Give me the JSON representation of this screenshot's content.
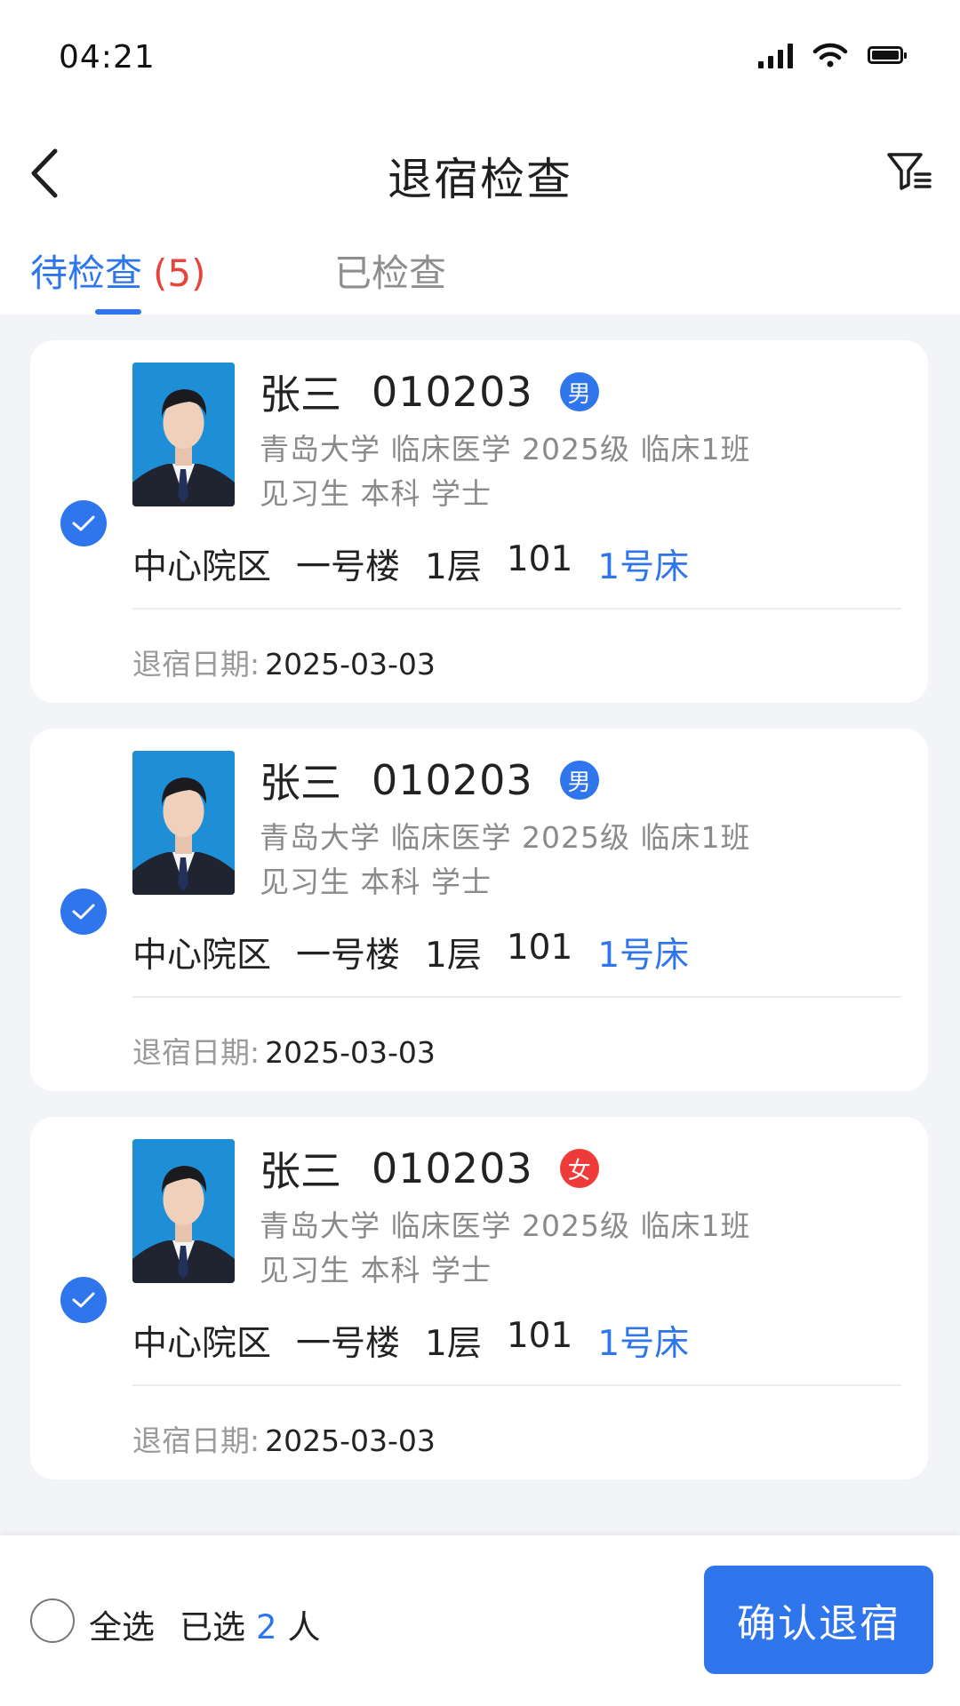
{
  "status_bar": {
    "time": "04:21"
  },
  "header": {
    "title": "退宿检查"
  },
  "tabs": [
    {
      "label": "待检查",
      "count": "(5)"
    },
    {
      "label": "已检查"
    }
  ],
  "colors": {
    "accent": "#2f75ec",
    "female": "#ef3a3a",
    "count_red": "#e8443b"
  },
  "cards": [
    {
      "name": "张三",
      "student_id": "010203",
      "gender": "男",
      "school": "青岛大学 临床医学 2025级 临床1班",
      "level": "见习生 本科 学士",
      "campus": "中心院区",
      "building": "一号楼",
      "floor": "1层",
      "room": "101",
      "bed": "1号床",
      "date_label": "退宿日期:",
      "date": "2025-03-03"
    },
    {
      "name": "张三",
      "student_id": "010203",
      "gender": "男",
      "school": "青岛大学 临床医学 2025级 临床1班",
      "level": "见习生 本科 学士",
      "campus": "中心院区",
      "building": "一号楼",
      "floor": "1层",
      "room": "101",
      "bed": "1号床",
      "date_label": "退宿日期:",
      "date": "2025-03-03"
    },
    {
      "name": "张三",
      "student_id": "010203",
      "gender": "女",
      "school": "青岛大学 临床医学 2025级 临床1班",
      "level": "见习生 本科 学士",
      "campus": "中心院区",
      "building": "一号楼",
      "floor": "1层",
      "room": "101",
      "bed": "1号床",
      "date_label": "退宿日期:",
      "date": "2025-03-03"
    }
  ],
  "footer": {
    "select_all": "全选",
    "selected_prefix": "已选",
    "selected_count": "2",
    "selected_suffix": "人",
    "confirm": "确认退宿"
  }
}
